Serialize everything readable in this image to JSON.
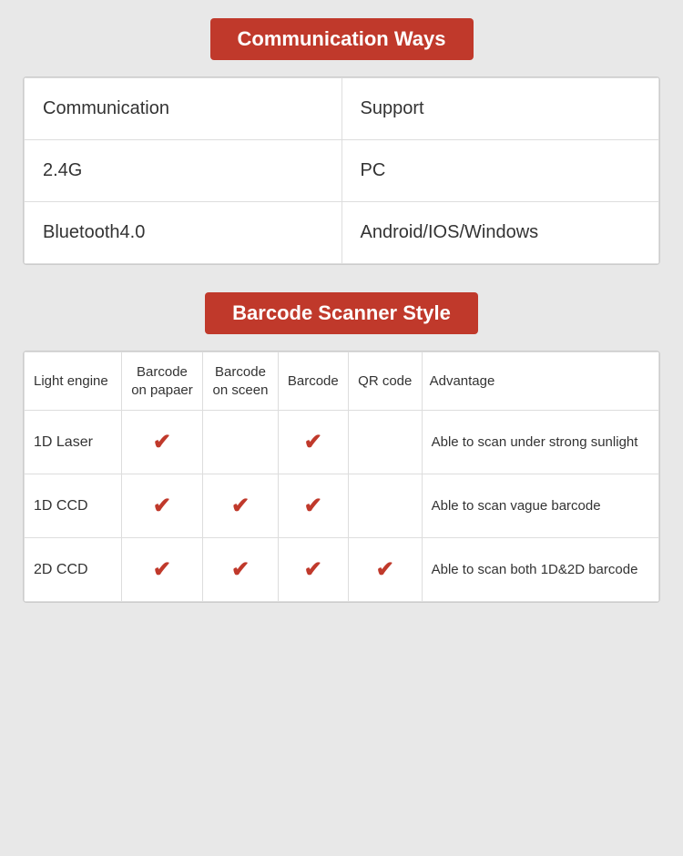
{
  "section1": {
    "title": "Communication Ways"
  },
  "comm_table": {
    "headers": [
      "Communication",
      "Support"
    ],
    "rows": [
      [
        "2.4G",
        "PC"
      ],
      [
        "Bluetooth4.0",
        "Android/IOS/Windows"
      ]
    ]
  },
  "section2": {
    "title": "Barcode Scanner Style"
  },
  "scanner_table": {
    "headers": [
      "Light engine",
      "Barcode\non papaer",
      "Barcode\non sceen",
      "Barcode",
      "QR code",
      "Advantage"
    ],
    "rows": [
      {
        "engine": "1D Laser",
        "col1": true,
        "col2": false,
        "col3": true,
        "col4": false,
        "advantage": "Able to scan under strong sunlight"
      },
      {
        "engine": "1D CCD",
        "col1": true,
        "col2": true,
        "col3": true,
        "col4": false,
        "advantage": "Able to scan vague barcode"
      },
      {
        "engine": "2D CCD",
        "col1": true,
        "col2": true,
        "col3": true,
        "col4": true,
        "advantage": "Able to scan both 1D&2D barcode"
      }
    ]
  }
}
